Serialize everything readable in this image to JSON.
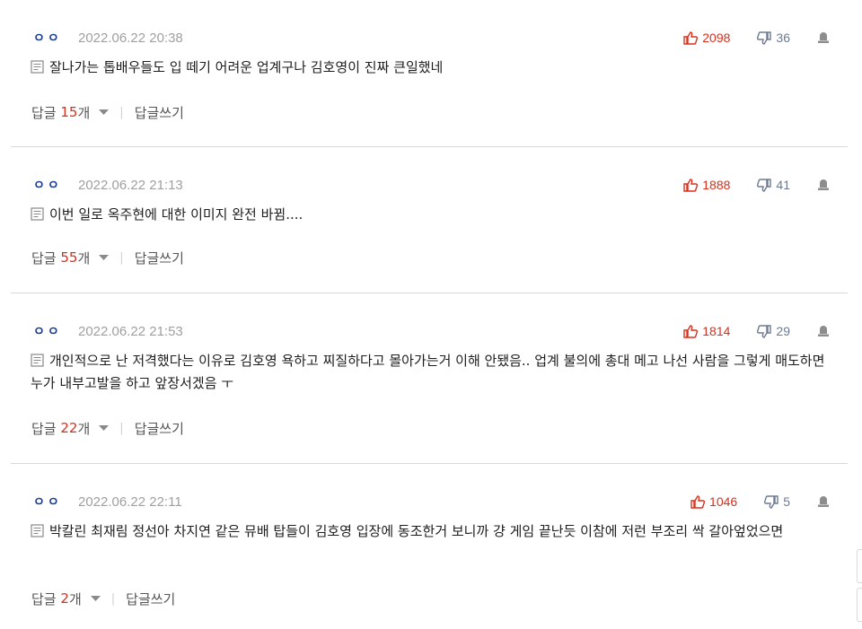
{
  "comments": [
    {
      "nickname": "ㅇㅇ",
      "datetime": "2022.06.22 20:38",
      "upvotes": "2098",
      "downvotes": "36",
      "text": "잘나가는 톱배우들도 입 떼기 어려운 업계구나 김호영이 진짜 큰일했네",
      "reply_label": "답글",
      "reply_count": "15",
      "reply_unit": "개",
      "write_label": "답글쓰기"
    },
    {
      "nickname": "ㅇㅇ",
      "datetime": "2022.06.22 21:13",
      "upvotes": "1888",
      "downvotes": "41",
      "text": "이번 일로 옥주현에 대한 이미지 완전 바뀜....",
      "reply_label": "답글",
      "reply_count": "55",
      "reply_unit": "개",
      "write_label": "답글쓰기"
    },
    {
      "nickname": "ㅇㅇ",
      "datetime": "2022.06.22 21:53",
      "upvotes": "1814",
      "downvotes": "29",
      "text": "개인적으로 난 저격했다는 이유로 김호영 욕하고 찌질하다고 몰아가는거 이해 안됐음.. 업계 불의에 총대 메고 나선 사람을 그렇게 매도하면 누가 내부고발을 하고 앞장서겠음 ㅜ",
      "reply_label": "답글",
      "reply_count": "22",
      "reply_unit": "개",
      "write_label": "답글쓰기"
    },
    {
      "nickname": "ㅇㅇ",
      "datetime": "2022.06.22 22:11",
      "upvotes": "1046",
      "downvotes": "5",
      "text": "박칼린 최재림 정선아 차지연 같은 뮤배 탑들이 김호영 입장에 동조한거 보니까 걍 게임 끝난듯 이참에 저런 부조리 싹 갈아엎었으면",
      "reply_label": "답글",
      "reply_count": "2",
      "reply_unit": "개",
      "write_label": "답글쓰기"
    }
  ],
  "colors": {
    "upvote": "#d8301c",
    "downvote": "#6c7b93",
    "nickname": "#1e3f8f",
    "date": "#a0a0a0"
  },
  "icons": {
    "upvote": "thumbs-up-icon",
    "downvote": "thumbs-down-icon",
    "report": "report-icon",
    "memo": "memo-icon",
    "caret": "caret-down-icon"
  }
}
